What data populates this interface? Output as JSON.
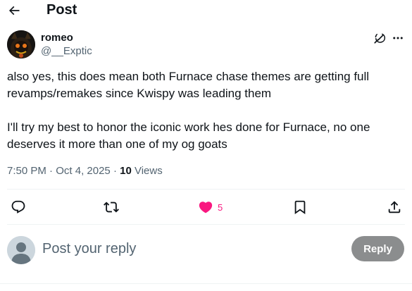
{
  "header": {
    "back_icon": "arrow-left-icon",
    "title": "Post"
  },
  "author": {
    "name": "romeo",
    "handle": "@__Exptic",
    "grok_icon": "grok-icon",
    "more_icon": "more-dots-icon"
  },
  "post": {
    "text": "also yes, this does mean both Furnace chase themes are getting full revamps/remakes since Kwispy was leading them\n\nI'll try my best to honor the iconic work hes done for Furnace, no one deserves it more than one of my og goats",
    "time": "7:50 PM",
    "separator": "·",
    "date": "Oct 4, 2025",
    "views_count": "10",
    "views_label": "Views"
  },
  "actions": {
    "reply_icon": "comment-icon",
    "repost_icon": "repost-icon",
    "like_icon": "heart-filled-icon",
    "like_count": "5",
    "bookmark_icon": "bookmark-icon",
    "share_icon": "share-icon"
  },
  "reply": {
    "placeholder": "Post your reply",
    "button_label": "Reply"
  },
  "colors": {
    "like": "#f91880",
    "secondary_text": "#536471",
    "reply_button": "#8b8d8e"
  }
}
